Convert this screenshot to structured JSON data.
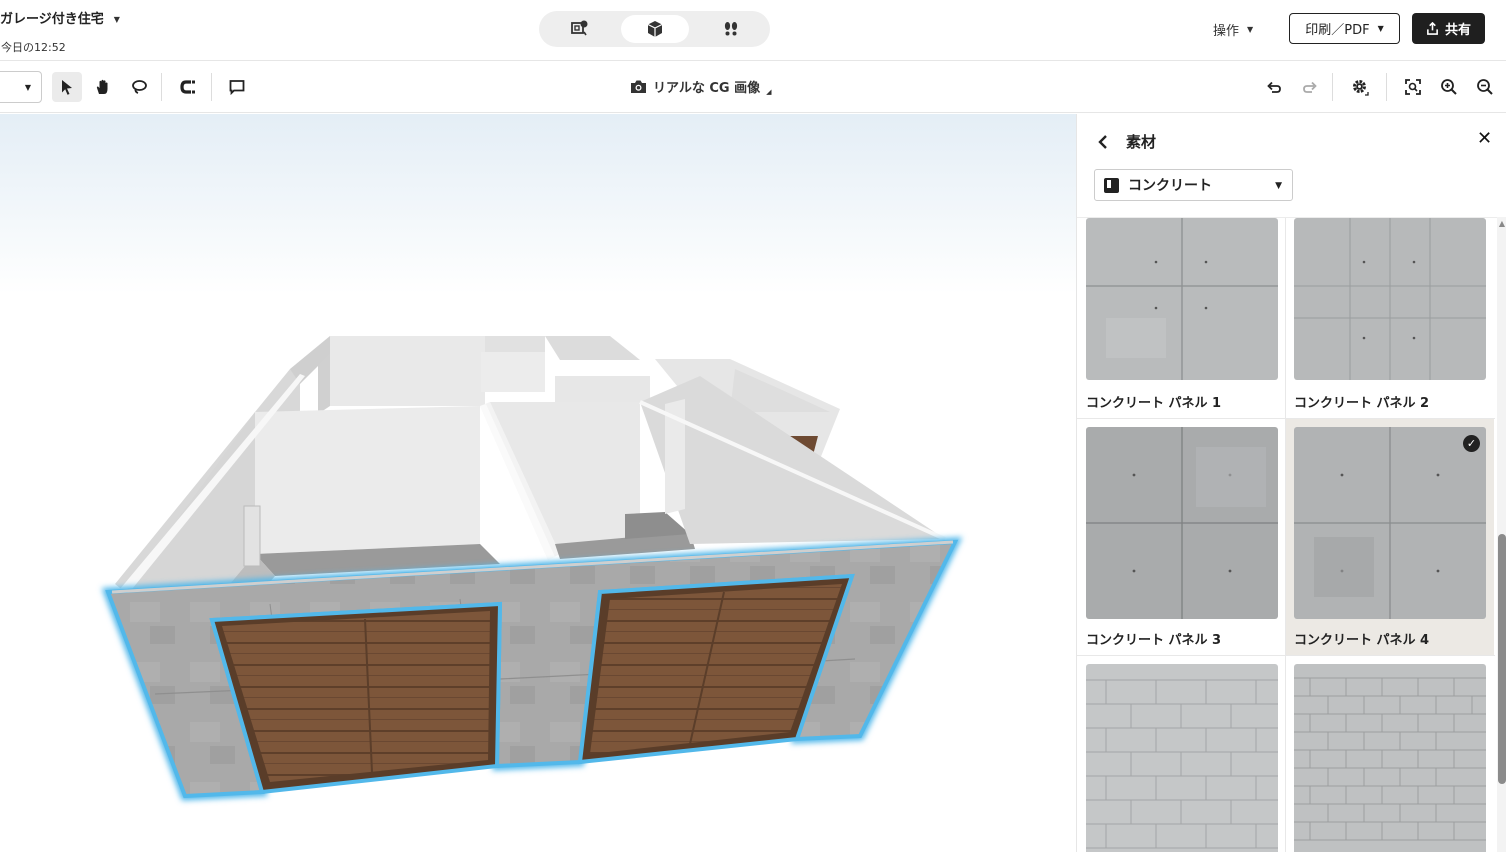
{
  "header": {
    "project_title": "ガレージ付き住宅",
    "saved_time": "今日の12:52",
    "operations_label": "操作",
    "print_label": "印刷／PDF",
    "share_label": "共有",
    "view_modes": [
      "2d-plan-icon",
      "3d-box-icon",
      "walk-footprints-icon"
    ],
    "active_view": "3d-box-icon"
  },
  "toolbar": {
    "render_label": "リアルな CG 画像",
    "tools": [
      "select-arrow-icon",
      "pan-hand-icon",
      "lasso-icon",
      "magnet-icon",
      "comment-icon"
    ],
    "right_tools": [
      "undo-icon",
      "redo-icon",
      "settings-icon",
      "fit-view-icon",
      "zoom-in-icon",
      "zoom-out-icon"
    ]
  },
  "panel": {
    "title": "素材",
    "category": "コンクリート",
    "materials": [
      {
        "name": "コンクリート パネル 1",
        "selected": false
      },
      {
        "name": "コンクリート パネル 2",
        "selected": false
      },
      {
        "name": "コンクリート パネル 3",
        "selected": false
      },
      {
        "name": "コンクリート パネル 4",
        "selected": true
      },
      {
        "name": "",
        "selected": false
      },
      {
        "name": "",
        "selected": false
      }
    ]
  },
  "colors": {
    "selection_outline": "#52b8ea",
    "concrete": "#a7a7a7",
    "garage_door": "#7a5438",
    "accent_dark": "#1f1f1f"
  }
}
